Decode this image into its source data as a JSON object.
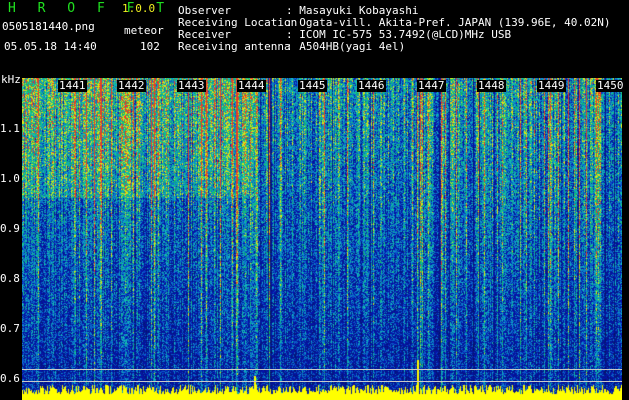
{
  "header": {
    "title": "H R O F F T",
    "version": "1.0.0",
    "filename": "0505181440.png",
    "datetime": "05.05.18 14:40",
    "meteor_label": "meteor",
    "meteor_count": "102"
  },
  "meta": [
    {
      "key": "Observer",
      "value": ": Masayuki Kobayashi"
    },
    {
      "key": "Receiving Location",
      "value": ": Ogata-vill. Akita-Pref. JAPAN (139.96E, 40.02N)"
    },
    {
      "key": "Receiver",
      "value": ": ICOM IC-575 53.7492(@LCD)MHz USB"
    },
    {
      "key": "Receiving antenna",
      "value": ": A504HB(yagi 4el)"
    }
  ],
  "plot": {
    "y_unit": "kHz",
    "y_ticks": [
      "1.1",
      "1.0",
      "0.9",
      "0.8",
      "0.7",
      "0.6"
    ],
    "y_range": [
      0.575,
      1.17
    ],
    "x_ticks": [
      "1441",
      "1442",
      "1443",
      "1444",
      "1445",
      "1446",
      "1447",
      "1448",
      "1449",
      "1450"
    ],
    "colors": {
      "background": "#0a1a78",
      "axis_text": "#ffffff",
      "title": "#20e020",
      "version": "#f0f020",
      "meteor_echo": "#ffff00"
    }
  }
}
